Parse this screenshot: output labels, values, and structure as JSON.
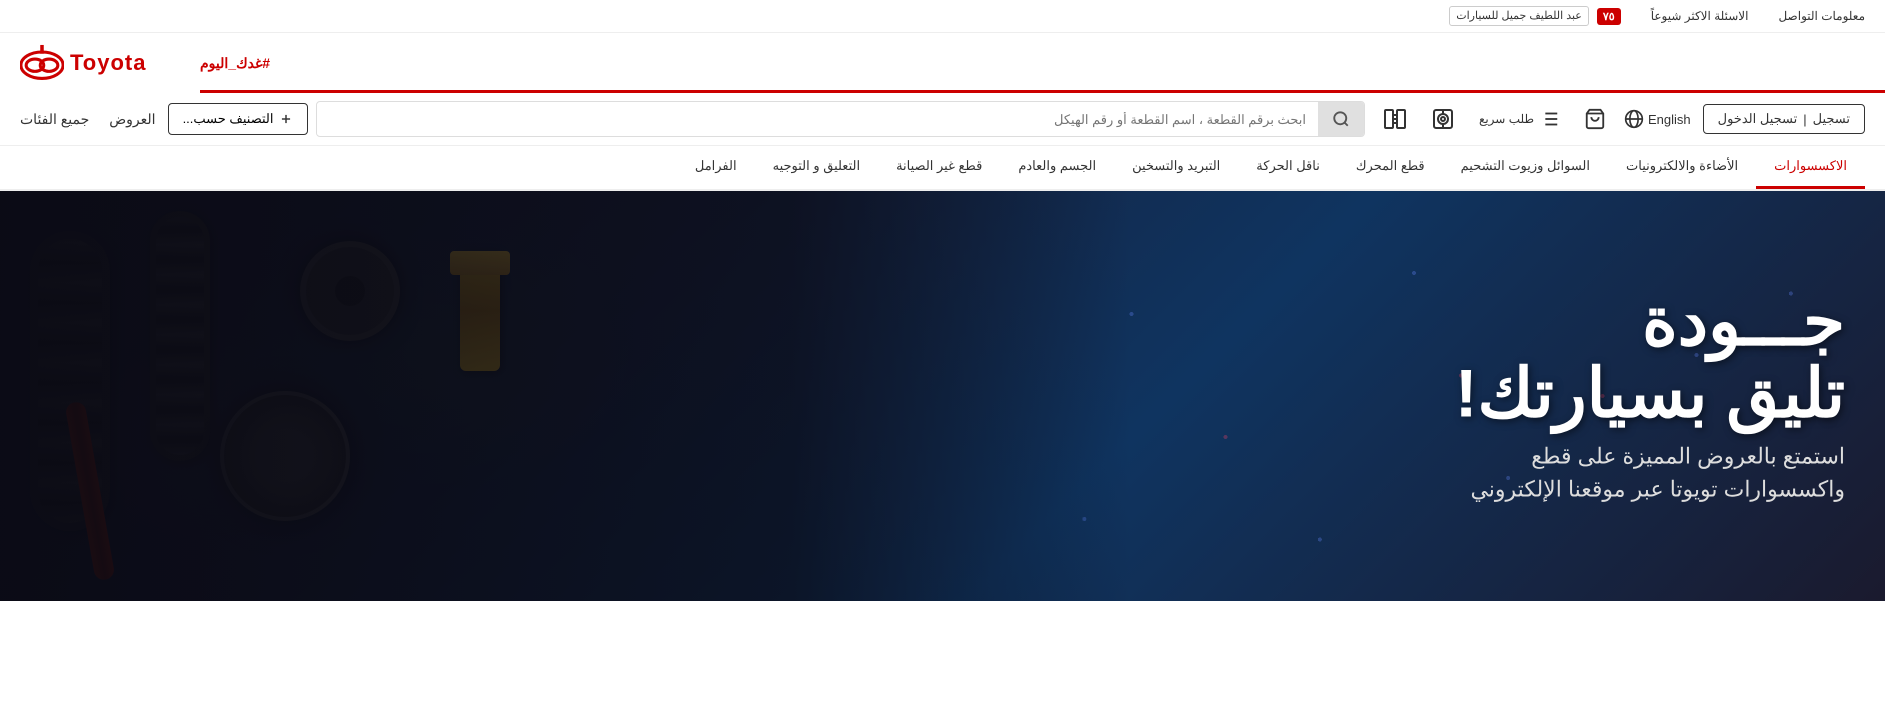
{
  "top_bar": {
    "logo_name": "عبد اللطيف جميل للسيارات",
    "anniversary": "٧٥",
    "faq_label": "الاسئلة الاكثر شيوعاً",
    "contact_label": "معلومات التواصل"
  },
  "header": {
    "hashtag": "#غدك_اليوم",
    "logo_alt": "Toyota"
  },
  "navbar": {
    "register_label": "تسجيل",
    "login_label": "تسجيل الدخول",
    "lang_label": "English",
    "cart_label": "",
    "quick_order_label": "طلب سريع",
    "scan_label": "",
    "compare_label": "",
    "search_placeholder": "ابحث برقم القطعة ، اسم القطعة أو رقم الهيكل",
    "classify_label": "التصنيف حسب...",
    "offers_label": "العروض",
    "all_categories_label": "جميع الفئات"
  },
  "categories": [
    {
      "label": "الاكسسوارات",
      "active": true
    },
    {
      "label": "الأضاءة والالكترونيات",
      "active": false
    },
    {
      "label": "السوائل وزيوت التشحيم",
      "active": false
    },
    {
      "label": "قطع المحرك",
      "active": false
    },
    {
      "label": "ناقل الحركة",
      "active": false
    },
    {
      "label": "التبريد والتسخين",
      "active": false
    },
    {
      "label": "الجسم والعادم",
      "active": false
    },
    {
      "label": "قطع غير الصيانة",
      "active": false
    },
    {
      "label": "التعليق و التوجيه",
      "active": false
    },
    {
      "label": "الفرامل",
      "active": false
    }
  ],
  "hero": {
    "title_line1": "جـــودة",
    "title_line2": "تليق بسيارتك!",
    "subtitle_line1": "استمتع بالعروض المميزة على قطع",
    "subtitle_line2": "واكسسوارات تويوتا عبر موقعنا الإلكتروني"
  }
}
